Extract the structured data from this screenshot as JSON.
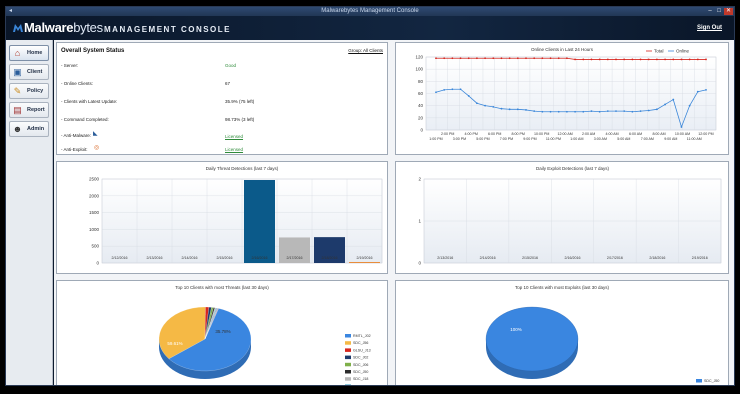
{
  "window": {
    "title": "Malwarebytes Management Console",
    "icon": "app-icon",
    "min_label": "–",
    "max_label": "□",
    "close_label": "✕"
  },
  "header": {
    "logo_bold": "Malware",
    "logo_light": "bytes",
    "console_title": "MANAGEMENT CONSOLE",
    "signout": "Sign Out"
  },
  "sidebar": {
    "items": [
      {
        "label": "Home",
        "icon": "home-icon",
        "glyph": "⌂"
      },
      {
        "label": "Client",
        "icon": "client-icon",
        "glyph": "▣"
      },
      {
        "label": "Policy",
        "icon": "policy-icon",
        "glyph": "✎"
      },
      {
        "label": "Report",
        "icon": "report-icon",
        "glyph": "▤"
      },
      {
        "label": "Admin",
        "icon": "admin-icon",
        "glyph": "☻"
      }
    ]
  },
  "status": {
    "title": "Overall System Status",
    "link": "Group: All Clients",
    "rows": [
      {
        "label": "- Server:",
        "value": "Good"
      },
      {
        "label": "- Online Clients:",
        "value": "67"
      },
      {
        "label": "- Clients with Latest Update:",
        "value": "35.9% (75 left)"
      },
      {
        "label": "- Command Completed:",
        "value": "98.73% (3 left)"
      },
      {
        "label": "- Anti-Malware:",
        "value": "Licensed"
      },
      {
        "label": "- Anti-Exploit:",
        "value": "Licensed"
      }
    ]
  },
  "colors": {
    "total": "#d7261e",
    "online": "#3a86d9",
    "bar_dark": "#0b5a8a",
    "bar_gray": "#b8b8b8",
    "bar_navy": "#1d3a6b",
    "bar_orange": "#e87b1a"
  },
  "chart_data": [
    {
      "type": "line",
      "title": "Online Clients in Last 24 Hours",
      "x": [
        "2:00 PM",
        "4:00 PM",
        "6:00 PM",
        "8:00 PM",
        "10:00 PM",
        "12:00 AM",
        "2:00 AM",
        "4:00 AM",
        "6:00 AM",
        "8:00 AM",
        "10:00 AM",
        "12:00 PM"
      ],
      "xticks_top": [
        "2:00 PM",
        "4:00 PM",
        "6:00 PM",
        "8:00 PM",
        "10:00 PM",
        "12:00 AM",
        "2:00 AM",
        "4:00 AM",
        "6:00 AM",
        "8:00 AM",
        "10:00 AM",
        "12:00 PM"
      ],
      "xticks_bottom": [
        "1:00 PM",
        "3:00 PM",
        "5:00 PM",
        "7:00 PM",
        "9:00 PM",
        "11:00 PM",
        "1:00 AM",
        "3:00 AM",
        "5:00 AM",
        "7:00 AM",
        "9:00 AM",
        "11:00 AM"
      ],
      "ylim": [
        0,
        120
      ],
      "yticks": [
        0,
        20,
        40,
        60,
        80,
        100,
        120
      ],
      "series": [
        {
          "name": "Total",
          "values": [
            118,
            118,
            118,
            118,
            118,
            118,
            118,
            118,
            118,
            118,
            118,
            118,
            118,
            118,
            118,
            118,
            118,
            116,
            116,
            116,
            116,
            116,
            116,
            116,
            116,
            116,
            116,
            116,
            116,
            116,
            116,
            116,
            116,
            116
          ]
        },
        {
          "name": "Online",
          "values": [
            62,
            66,
            67,
            67,
            56,
            44,
            40,
            38,
            35,
            34,
            34,
            33,
            31,
            30,
            30,
            30,
            30,
            30,
            30,
            31,
            30,
            31,
            31,
            31,
            30,
            31,
            32,
            34,
            42,
            50,
            5,
            40,
            63,
            66
          ]
        }
      ]
    },
    {
      "type": "bar",
      "title": "Daily Threat Detections (last 7 days)",
      "categories": [
        "2/12/2016",
        "2/13/2016",
        "2/14/2016",
        "2/15/2016",
        "2/16/2016",
        "2/17/2016",
        "2/18/2016",
        "2/19/2016"
      ],
      "values": [
        0,
        0,
        0,
        0,
        2470,
        760,
        770,
        25
      ],
      "ylim": [
        0,
        2500
      ],
      "yticks": [
        0,
        500,
        1000,
        1500,
        2000,
        2500
      ]
    },
    {
      "type": "bar",
      "title": "Daily Exploit Detections (last 7 days)",
      "categories": [
        "2/13/2016",
        "2/14/2016",
        "2/15/2016",
        "2/16/2016",
        "2/17/2016",
        "2/18/2016",
        "2/19/2016"
      ],
      "values": [
        0,
        0,
        0,
        0,
        0,
        0,
        0
      ],
      "ylim": [
        0,
        2
      ],
      "yticks": [
        0,
        1,
        2
      ]
    },
    {
      "type": "pie",
      "title": "Top 10 Clients with most Threats (last 30 days)",
      "labels": [
        "RMTL_J02",
        "SDC_J56",
        "GLSU_J13",
        "SDC_J02",
        "SDC_J06",
        "SDC_J50",
        "SDC_J18",
        "SDC_J02",
        "RMTL_J76",
        "DTMN600",
        "SDC_J36"
      ],
      "values": [
        59.61,
        35.78,
        1.2,
        0.9,
        0.7,
        0.5,
        0.4,
        0.3,
        0.25,
        0.2,
        0.16
      ],
      "data_labels": [
        "59.61%",
        "35.78%"
      ]
    },
    {
      "type": "pie",
      "title": "Top 10 Clients with most Exploits (last 30 days)",
      "labels": [
        "SDC_J50"
      ],
      "values": [
        100
      ],
      "data_labels": [
        "100%"
      ]
    }
  ]
}
